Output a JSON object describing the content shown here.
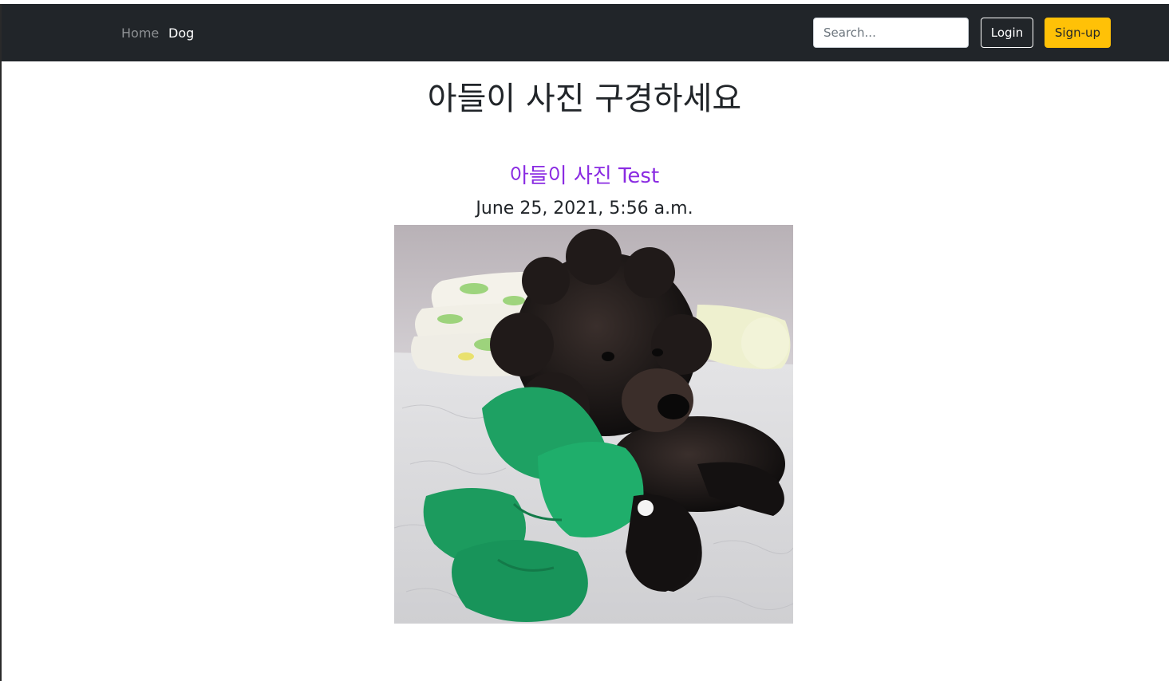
{
  "navbar": {
    "links": [
      {
        "label": "Home",
        "active": false
      },
      {
        "label": "Dog",
        "active": true
      }
    ],
    "search_placeholder": "Search...",
    "login_label": "Login",
    "signup_label": "Sign-up"
  },
  "main": {
    "heading": "아들이 사진 구경하세요",
    "post": {
      "title": "아들이 사진 Test",
      "date": "June 25, 2021, 5:56 a.m.",
      "image_subject": "black poodle lying on a white quilted bed with a green plush toy"
    }
  },
  "colors": {
    "navbar_bg": "#212529",
    "signup_bg": "#ffc107",
    "post_title": "#8a2be2"
  }
}
